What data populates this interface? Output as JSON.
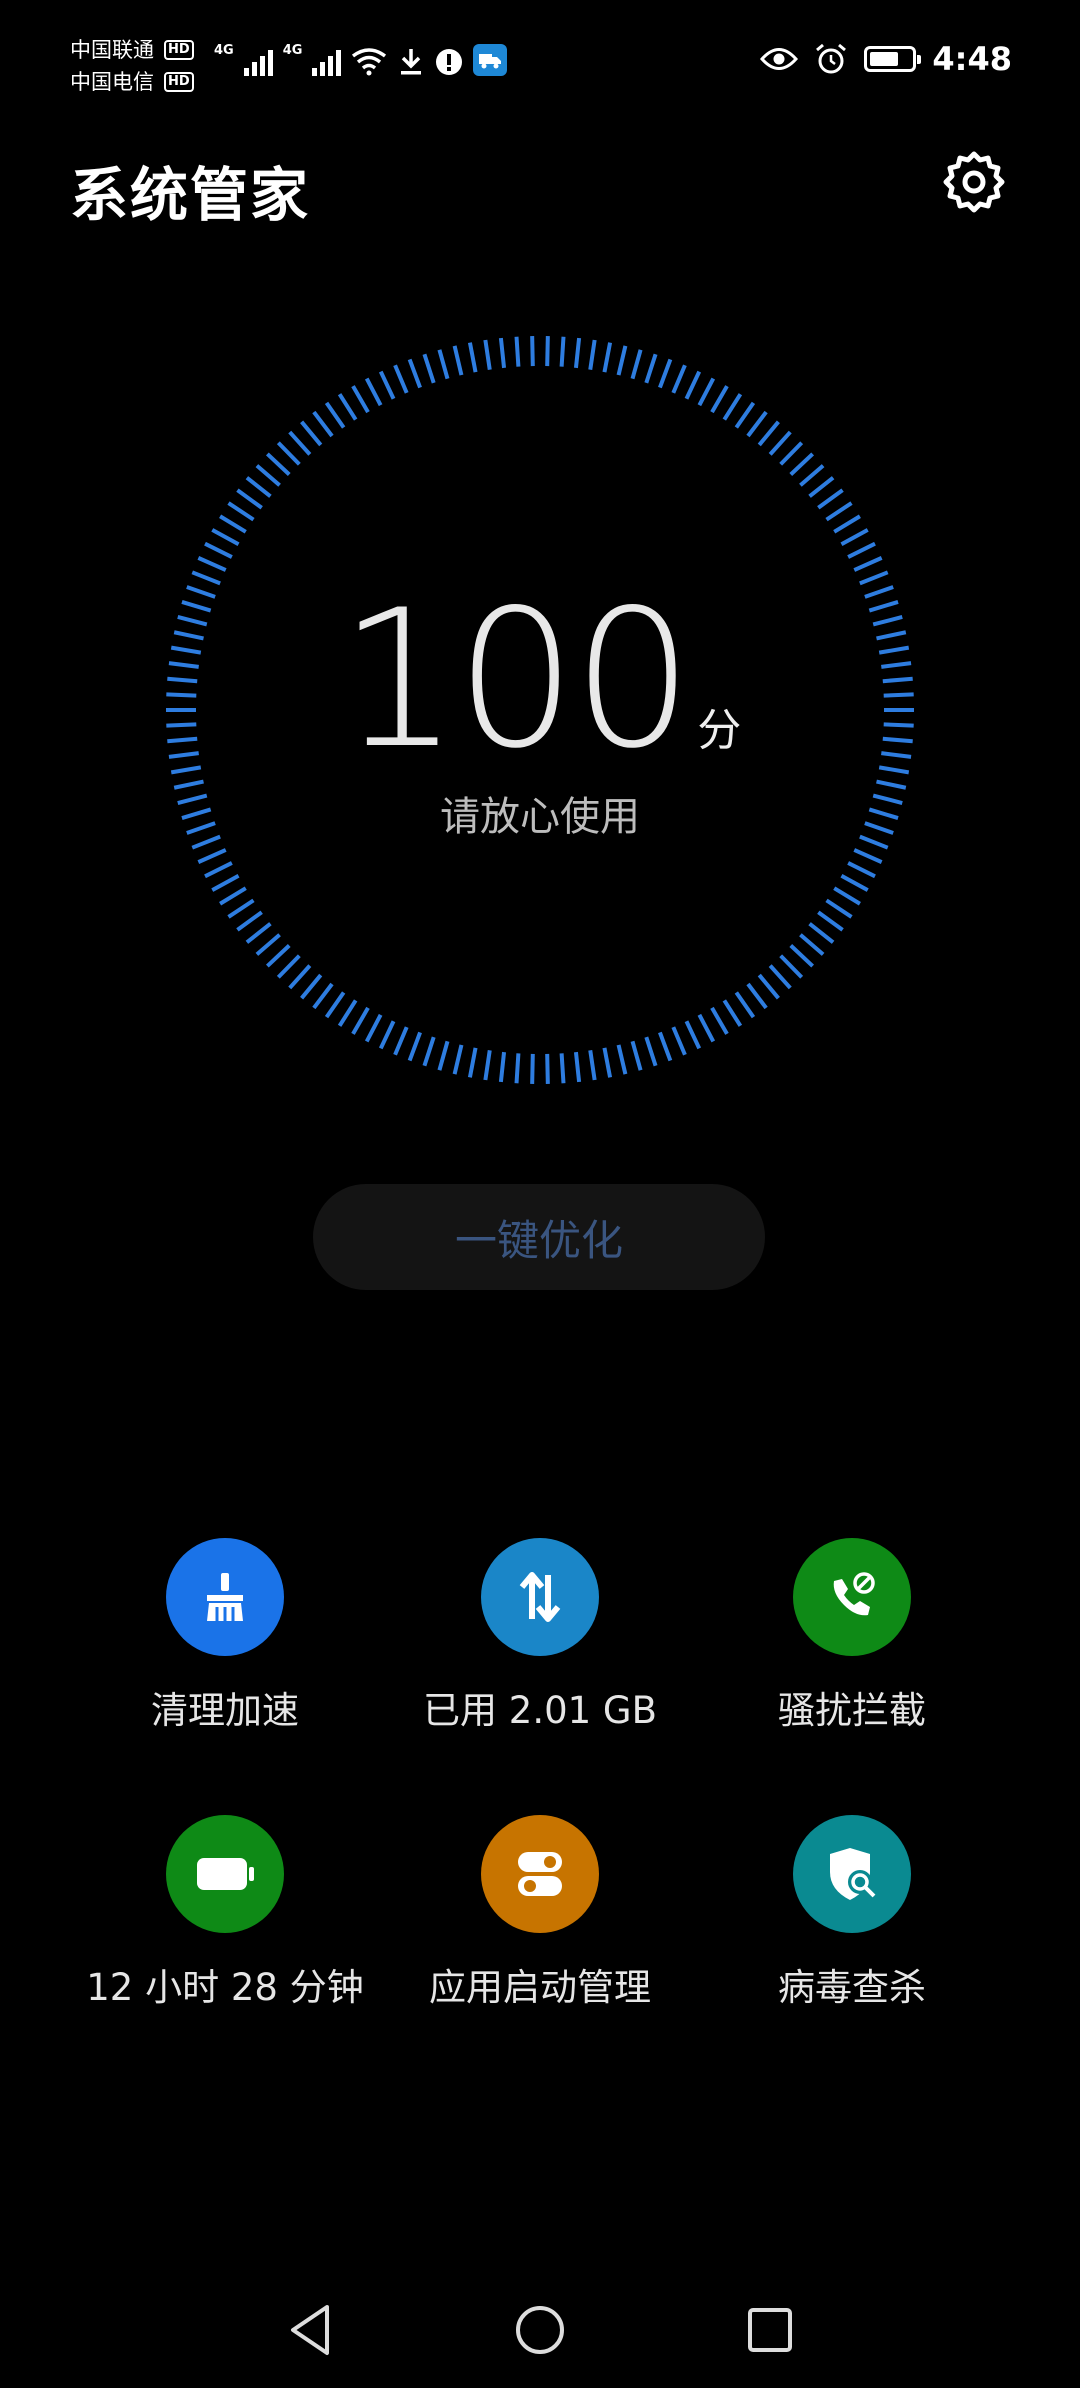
{
  "status_bar": {
    "carrier1": "中国联通",
    "carrier2": "中国电信",
    "hd_badge": "HD",
    "network_type": "4G",
    "time": "4:48"
  },
  "header": {
    "title": "系统管家",
    "settings_icon": "gear-icon"
  },
  "score": {
    "value": "100",
    "unit": "分",
    "status_text": "请放心使用",
    "ring_color": "#2e7de0"
  },
  "optimize_button": {
    "label": "一键优化"
  },
  "features": [
    {
      "label": "清理加速",
      "icon": "broom-icon",
      "color": "#1a73e8"
    },
    {
      "label": "已用 2.01 GB",
      "icon": "data-arrows-icon",
      "color": "#1a86c8"
    },
    {
      "label": "骚扰拦截",
      "icon": "phone-block-icon",
      "color": "#0e8a16"
    },
    {
      "label": "12 小时 28 分钟",
      "icon": "battery-icon",
      "color": "#0e8a16"
    },
    {
      "label": "应用启动管理",
      "icon": "toggle-icon",
      "color": "#c77400"
    },
    {
      "label": "病毒查杀",
      "icon": "shield-search-icon",
      "color": "#0a8a91"
    }
  ],
  "nav": {
    "back_icon": "back-triangle-icon",
    "home_icon": "home-circle-icon",
    "recents_icon": "recents-square-icon"
  }
}
